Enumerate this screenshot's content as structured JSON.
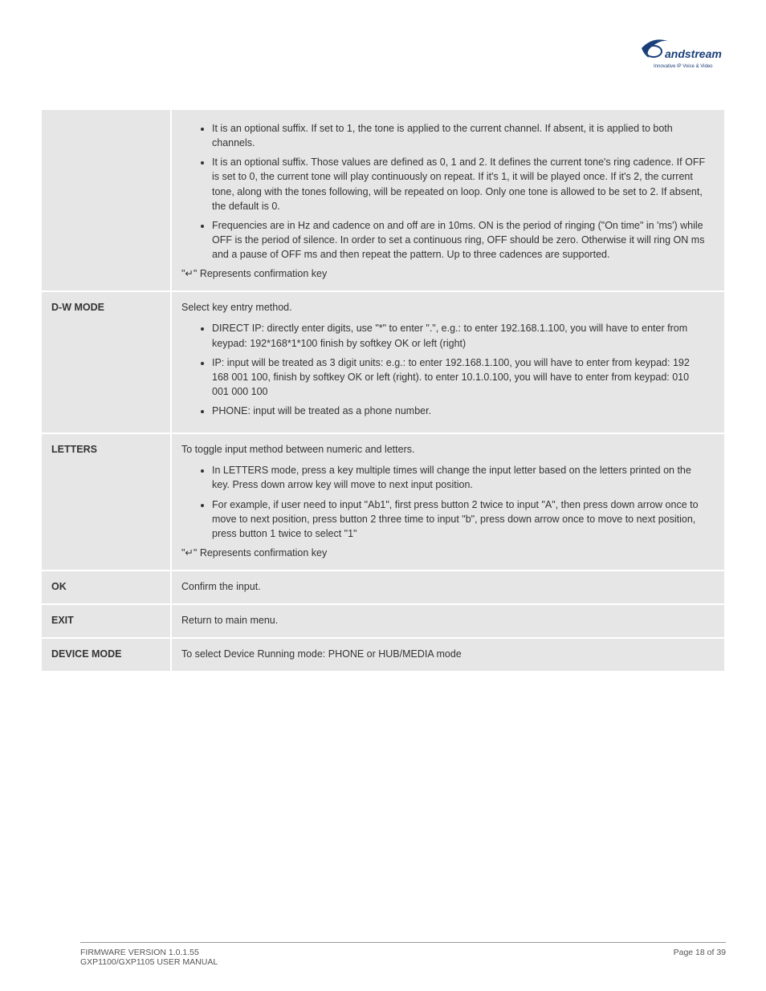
{
  "logo": {
    "brand": "Grandstream",
    "tagline": "Innovative IP Voice & Video"
  },
  "rows": [
    {
      "label": "",
      "items": [
        "It is an optional suffix. If set to 1, the tone is applied to the current channel. If absent, it is applied to both channels.",
        "It is an optional suffix. Those values are defined as 0, 1 and 2. It defines the current tone's ring cadence. If OFF is set to 0, the current tone will play continuously on repeat. If it's 1, it will be played once. If it's 2, the current tone, along with the tones following, will be repeated on loop. Only one tone is allowed to be set to 2. If absent, the default is 0.",
        "Frequencies are in Hz and cadence on and off are in 10ms. ON is the period of ringing (\"On time\" in 'ms') while OFF is the period of silence. In order to set a continuous ring, OFF should be zero. Otherwise it will ring ON ms and a pause of OFF ms and then repeat the pattern. Up to three cadences are supported."
      ],
      "note": "\"↵\" Represents confirmation key"
    },
    {
      "label": "D-W MODE",
      "intro": "Select key entry method.",
      "items": [
        "DIRECT IP: directly enter digits, use \"*\" to enter \".\", e.g.: to enter 192.168.1.100, you will have to enter from keypad: 192*168*1*100 finish by softkey OK or left (right)",
        "IP: input will be treated as 3 digit units: e.g.: to enter 192.168.1.100, you will have to enter from keypad: 192 168 001 100, finish by softkey OK or left (right). to enter 10.1.0.100, you will have to enter from keypad: 010 001 000 100",
        "PHONE: input will be treated as a phone number."
      ]
    },
    {
      "label": "LETTERS",
      "intro": "To toggle input method between numeric and letters.",
      "items": [
        "In LETTERS mode, press a key multiple times will change the input letter based on the letters printed on the key. Press down arrow key will move to next input position.",
        "For example, if user need to input \"Ab1\", first press button 2 twice to input \"A\", then press down arrow once to move to next position, press button 2 three time to input \"b\", press down arrow once to move to next position, press button 1 twice to select \"1\""
      ],
      "note": "\"↵\" Represents confirmation key"
    },
    {
      "label": "OK",
      "plain": "Confirm the input."
    },
    {
      "label": "EXIT",
      "plain": "Return to main menu."
    },
    {
      "label": "DEVICE MODE",
      "plain": "To select Device Running mode: PHONE or HUB/MEDIA mode"
    }
  ],
  "footer": {
    "left_line1": "FIRMWARE VERSION 1.0.1.55",
    "left_line2": "GXP1100/GXP1105 USER MANUAL",
    "right": "Page 18 of 39"
  }
}
